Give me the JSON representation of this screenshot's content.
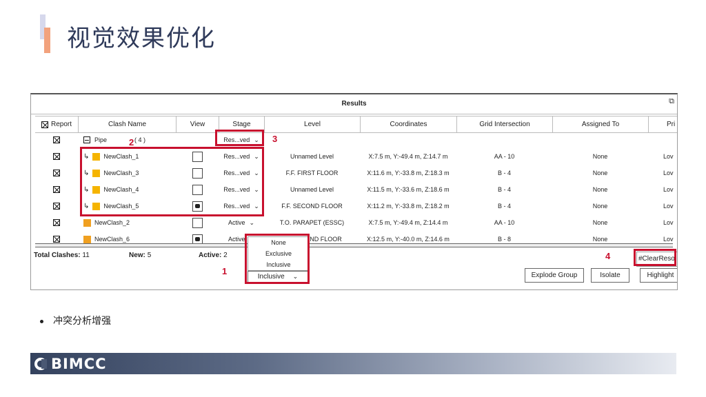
{
  "slide": {
    "title": "视觉效果优化",
    "bullet": "冲突分析增强",
    "logo_text": "BIMCC"
  },
  "window": {
    "title": "Results",
    "icon": "restore-window-icon"
  },
  "table": {
    "headers": [
      "Report",
      "Clash Name",
      "View",
      "Stage",
      "Level",
      "Coordinates",
      "Grid Intersection",
      "Assigned To",
      "Pri"
    ],
    "group_row": {
      "name": "Pipe",
      "count": "( 4 )",
      "stage": "Res...ved"
    },
    "rows": [
      {
        "name": "NewClash_1",
        "child": true,
        "view": "",
        "stage": "Res...ved",
        "level": "Unnamed Level",
        "coords": "X:7.5 m, Y:-49.4 m, Z:14.7 m",
        "grid": "AA - 10",
        "assigned": "None",
        "pri": "Lov"
      },
      {
        "name": "NewClash_3",
        "child": true,
        "view": "",
        "stage": "Res...ved",
        "level": "F.F. FIRST FLOOR",
        "coords": "X:11.6 m, Y:-33.8 m, Z:18.3 m",
        "grid": "B - 4",
        "assigned": "None",
        "pri": "Lov"
      },
      {
        "name": "NewClash_4",
        "child": true,
        "view": "",
        "stage": "Res...ved",
        "level": "Unnamed Level",
        "coords": "X:11.5 m, Y:-33.6 m, Z:18.6 m",
        "grid": "B - 4",
        "assigned": "None",
        "pri": "Lov"
      },
      {
        "name": "NewClash_5",
        "child": true,
        "view": "cam",
        "stage": "Res...ved",
        "level": "F.F. SECOND FLOOR",
        "coords": "X:11.2 m, Y:-33.8 m, Z:18.2 m",
        "grid": "B - 4",
        "assigned": "None",
        "pri": "Lov"
      },
      {
        "name": "NewClash_2",
        "child": false,
        "view": "",
        "stage": "Active",
        "level": "T.O. PARAPET (ESSC)",
        "coords": "X:7.5 m, Y:-49.4 m, Z:14.4 m",
        "grid": "AA - 10",
        "assigned": "None",
        "pri": "Lov"
      },
      {
        "name": "NewClash_6",
        "child": false,
        "view": "cam",
        "stage": "Active",
        "level": "ND FLOOR",
        "coords": "X:12.5 m, Y:-40.0 m, Z:14.6 m",
        "grid": "B - 8",
        "assigned": "None",
        "pri": "Lov"
      }
    ]
  },
  "footer": {
    "total_label": "Total Clashes:",
    "total_value": "11",
    "new_label": "New:",
    "new_value": "5",
    "active_label": "Active:",
    "active_value": "2",
    "clear_button": "#ClearReso",
    "explode_button": "Explode Group",
    "isolate_button": "Isolate",
    "highlight_button": "Highlight"
  },
  "dropdown": {
    "options": [
      "None",
      "Exclusive",
      "Inclusive"
    ],
    "selected": "Inclusive"
  },
  "annotations": [
    "1",
    "2",
    "3",
    "4"
  ],
  "colors": {
    "annotation_red": "#c8102e",
    "title_color": "#2f3a5a",
    "clash_square": "#f5b400"
  }
}
